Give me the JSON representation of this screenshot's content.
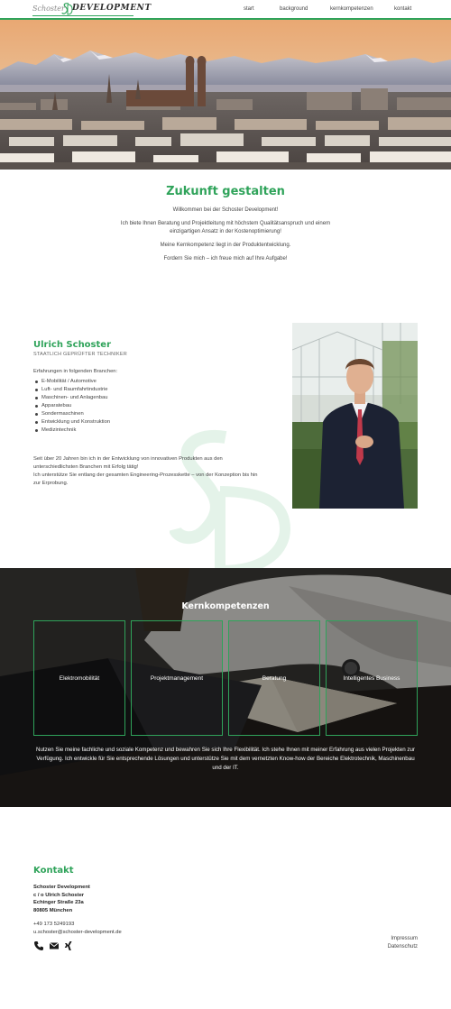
{
  "header": {
    "logo_small": "Schoster",
    "logo_big": "DEVELOPMENT",
    "nav": [
      "start",
      "background",
      "kernkompetenzen",
      "kontakt"
    ]
  },
  "intro": {
    "title": "Zukunft gestalten",
    "lines": [
      "Willkommen bei der Schoster Development!",
      "Ich biete Ihnen Beratung und Projektleitung mit höchstem Qualitätsanspruch und einem einzigartigen Ansatz in der Kostenoptimierung!",
      "Meine Kernkompetenz liegt in der Produktentwicklung.",
      "Fordern Sie mich – ich freue mich auf Ihre Aufgabe!"
    ]
  },
  "profile": {
    "name": "Ulrich Schoster",
    "title": "STAATLICH GEPRÜFTER TECHNIKER",
    "experience_label": "Erfahrungen in folgenden Branchen:",
    "branches": [
      "E-Mobilität / Automotive",
      "Luft- und Raumfahrtindustrie",
      "Maschinen- und Anlagenbau",
      "Apparatebau",
      "Sondermaschinen",
      "Entwicklung und Konstruktion",
      "Medizintechnik"
    ],
    "desc_1": "Seit über 20 Jahren bin ich in der Entwicklung von innovativen Produkten aus den unterschiedlichsten Branchen mit Erfolg tätig!",
    "desc_2": "Ich unterstütze Sie entlang der gesamten Engineering-Prozesskette – von der Konzeption bis hin zur Erprobung."
  },
  "competencies": {
    "title": "Kernkompetenzen",
    "boxes": [
      "Elektromobilität",
      "Projektmanagement",
      "Beratung",
      "Intelligentes Business"
    ],
    "text": "Nutzen Sie meine fachliche und soziale Kompetenz und bewahren Sie sich Ihre Flexibilität. Ich stehe Ihnen mit meiner Erfahrung aus vielen Projekten zur Verfügung. Ich entwickle für Sie entsprechende Lösungen und unterstütze Sie mit dem vernetzten Know-how der Bereiche Elektrotechnik, Maschinenbau und der IT."
  },
  "contact": {
    "title": "Kontakt",
    "address": [
      "Schoster Development",
      "c / o Ulrich Schoster",
      "Echinger Straße 23a",
      "80805 München"
    ],
    "phone": "+49 173 5249193",
    "email": "u.schoster@schoster-development.de",
    "icons": [
      "phone-icon",
      "mail-icon",
      "xing-icon"
    ],
    "impressum": "Impressum",
    "datenschutz": "Datenschutz"
  },
  "colors": {
    "accent": "#2fa35a",
    "dark_section": "#2b2a28",
    "text": "#444444"
  }
}
